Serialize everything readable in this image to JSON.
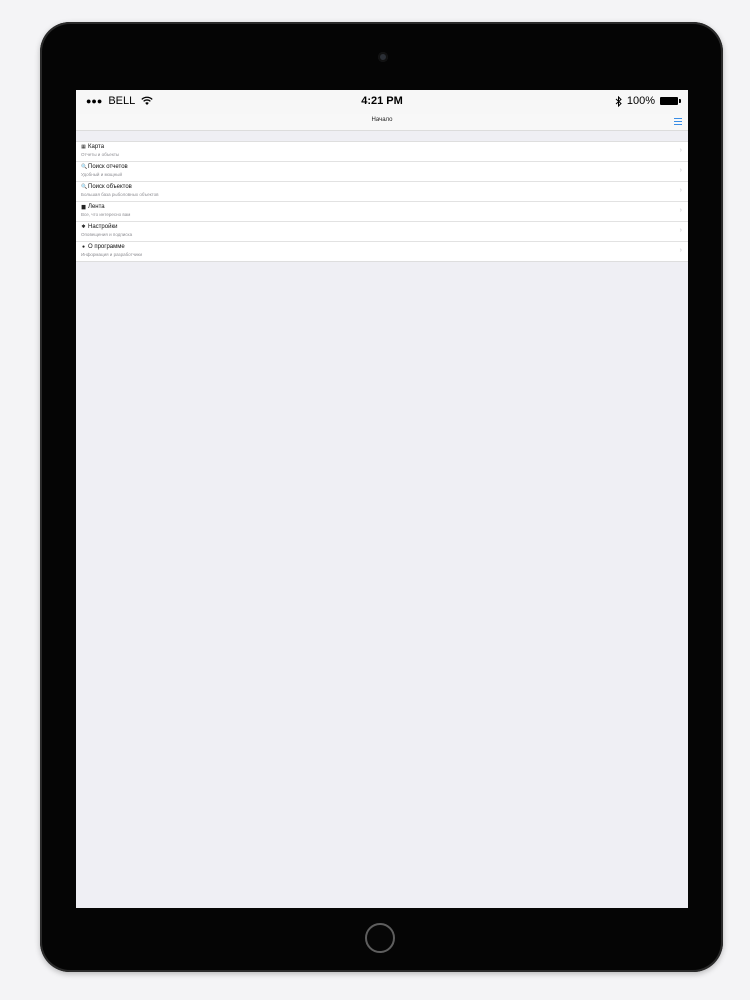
{
  "status_bar": {
    "signal": "●●●",
    "carrier": "BELL",
    "time": "4:21 PM",
    "battery": "100%"
  },
  "nav": {
    "title": "Начало"
  },
  "menu": [
    {
      "icon": "▦",
      "icon_name": "map-icon",
      "title": "Карта",
      "subtitle": "Отчеты и объекты"
    },
    {
      "icon": "🔍",
      "icon_name": "search-icon",
      "title": "Поиск отчетов",
      "subtitle": "Удобный и мощный"
    },
    {
      "icon": "🔍",
      "icon_name": "search-icon",
      "title": "Поиск объектов",
      "subtitle": "Большая база рыболовных объектов"
    },
    {
      "icon": "▆",
      "icon_name": "feed-icon",
      "title": "Лента",
      "subtitle": "Все, что интересно вам"
    },
    {
      "icon": "✱",
      "icon_name": "settings-icon",
      "title": "Настройки",
      "subtitle": "Оповещения и подписка"
    },
    {
      "icon": "●",
      "icon_name": "info-icon",
      "title": "О программе",
      "subtitle": "Информация и разработчики"
    }
  ],
  "chevron": "›"
}
